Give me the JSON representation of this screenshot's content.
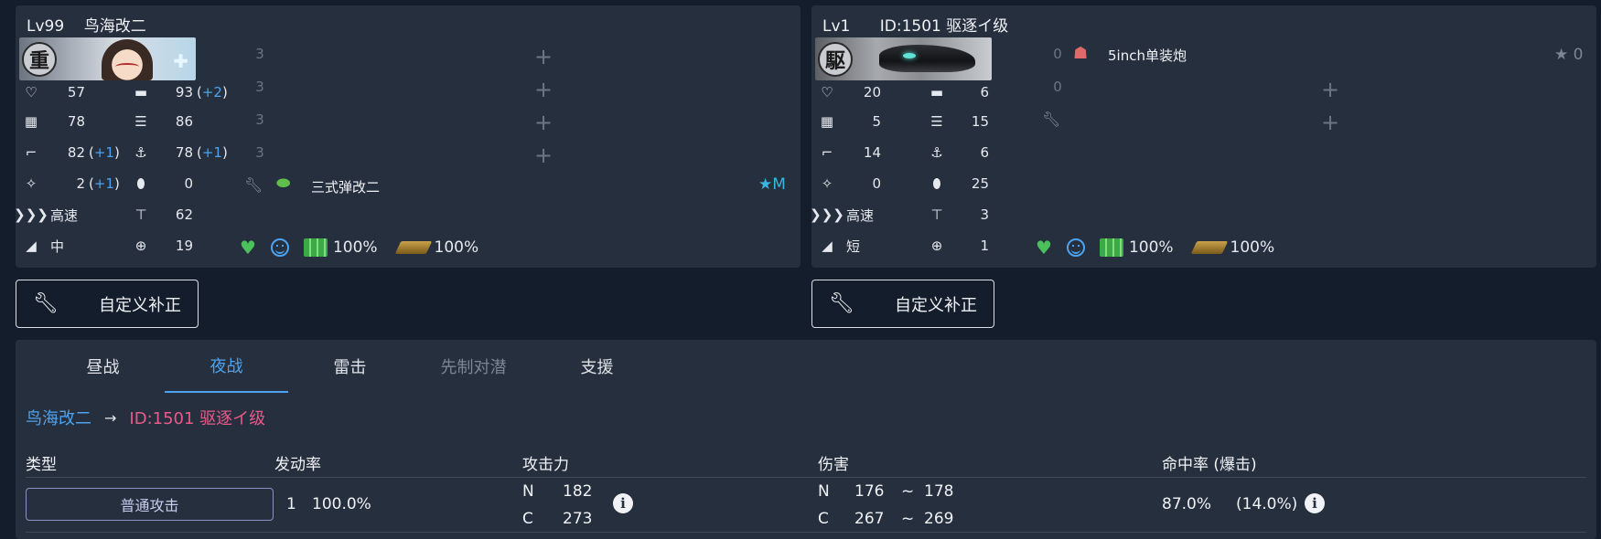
{
  "left_ship": {
    "title": "Lv99    鸟海改二",
    "banner_kanji": "重",
    "stats": {
      "hp": "57",
      "firepower": "93",
      "firepower_bonus": "+2",
      "armor": "78",
      "torpedo": "86",
      "aa": "82",
      "aa_bonus": "+1",
      "asw": "78",
      "asw_bonus": "+1",
      "evasion": "2",
      "evasion_bonus": "+1",
      "luck": "0",
      "speed": "高速",
      "los": "62",
      "range": "中",
      "accuracy": "19"
    },
    "slots": [
      "3",
      "3",
      "3",
      "3"
    ],
    "expansion_equip": {
      "name": "三式弹改二",
      "star": "★M"
    },
    "fuel": "100%",
    "ammo": "100%"
  },
  "right_ship": {
    "title": "Lv1      ID:1501 驱逐イ级",
    "banner_kanji": "駆",
    "stats": {
      "hp": "20",
      "firepower": "6",
      "armor": "5",
      "torpedo": "15",
      "aa": "14",
      "asw": "6",
      "evasion": "0",
      "luck": "25",
      "speed": "高速",
      "los": "3",
      "range": "短",
      "accuracy": "1"
    },
    "slots": [
      "0",
      "0"
    ],
    "equip1": {
      "name": "5inch单装炮",
      "star": "★ 0"
    },
    "fuel": "100%",
    "ammo": "100%"
  },
  "custom_button_label": "自定义补正",
  "tabs": [
    "昼战",
    "夜战",
    "雷击",
    "先制对潜",
    "支援"
  ],
  "active_tab": "夜战",
  "route": {
    "from": "鸟海改二",
    "arrow": "→",
    "to": "ID:1501 驱逐イ级"
  },
  "table": {
    "headers": [
      "类型",
      "发动率",
      "攻击力",
      "伤害",
      "命中率 (爆击)"
    ],
    "row": {
      "type": "普通攻击",
      "count": "1",
      "rate": "100.0%",
      "power_n_label": "N",
      "power_n": "182",
      "power_c_label": "C",
      "power_c": "273",
      "damage_n_label": "N",
      "damage_n_min": "176",
      "damage_n_max": "178",
      "damage_c_label": "C",
      "damage_c_min": "267",
      "damage_c_max": "269",
      "tilde": "~",
      "hit": "87.0%",
      "crit": "(14.0%)"
    }
  },
  "colors": {
    "accent": "#4da3f0",
    "enemy": "#e85a8a",
    "card": "#262f3e",
    "background": "#141d2b",
    "star": "#38b8e0"
  }
}
